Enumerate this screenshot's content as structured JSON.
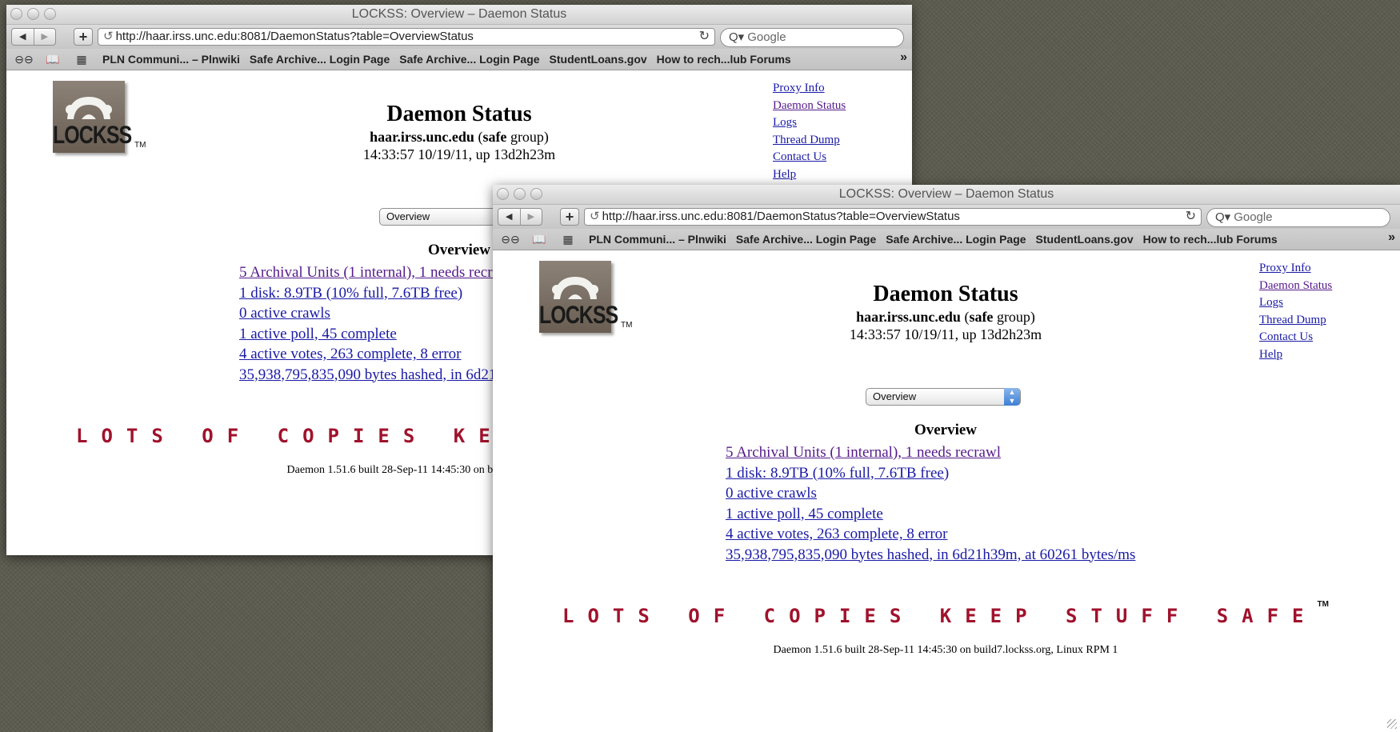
{
  "window": {
    "title": "LOCKSS: Overview – Daemon Status",
    "url": "http://haar.irss.unc.edu:8081/DaemonStatus?table=OverviewStatus",
    "search_placeholder": "Google",
    "back_icon": "◀",
    "forward_icon": "▶",
    "add_icon": "+",
    "reload_icon": "↻",
    "feed_icon": "↺",
    "search_icon": "Q▾"
  },
  "bookmarks": {
    "items": [
      "PLN Communi... – Plnwiki",
      "Safe Archive... Login Page",
      "Safe Archive... Login Page",
      "StudentLoans.gov",
      "How to rech...lub Forums"
    ],
    "more": "»"
  },
  "page": {
    "logo_text": "LOCKSS",
    "tm": "TM",
    "title": "Daemon Status",
    "host": "haar.irss.unc.edu",
    "group_open": " (",
    "group_name": "safe",
    "group_close": " group)",
    "time": "14:33:57 10/19/11, up 13d2h23m",
    "nav": [
      "Proxy Info",
      "Daemon Status",
      "Logs",
      "Thread Dump",
      "Contact Us",
      "Help"
    ],
    "select_value": "Overview",
    "overview_heading": "Overview",
    "overview_links": [
      "5 Archival Units (1 internal), 1 needs recrawl",
      "1 disk: 8.9TB (10% full, 7.6TB free)",
      "0 active crawls",
      "1 active poll, 45 complete",
      "4 active votes, 263 complete, 8 error",
      "35,938,795,835,090 bytes hashed, in 6d21h39m, at 60261 bytes/ms"
    ],
    "tagline": "LOTS OF COPIES KEEP STUFF SAFE",
    "tagline_tm": "TM",
    "footer": "Daemon 1.51.6 built 28-Sep-11 14:45:30 on build7.lockss.org, Linux RPM 1"
  },
  "colors": {
    "link": "#1a1aa6",
    "visited_link": "#551a8b",
    "tagline": "#a0122c",
    "desktop": "#5c5c50"
  }
}
